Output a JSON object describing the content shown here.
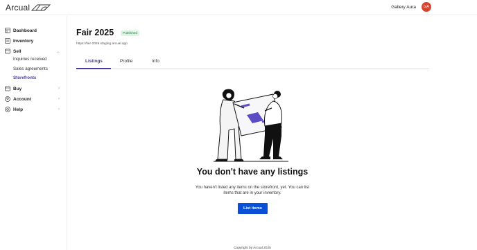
{
  "header": {
    "logo_text": "Arcual",
    "user_name": "Gallery Aura",
    "avatar_initials": "GA",
    "avatar_color": "#d9432f"
  },
  "sidebar": {
    "items": [
      {
        "label": "Dashboard",
        "icon": "dashboard-icon"
      },
      {
        "label": "Inventory",
        "icon": "inventory-icon"
      },
      {
        "label": "Sell",
        "icon": "sell-icon",
        "expanded": true,
        "children": [
          {
            "label": "Inquiries received"
          },
          {
            "label": "Sales agreements"
          },
          {
            "label": "Storefronts",
            "active": true
          }
        ]
      },
      {
        "label": "Buy",
        "icon": "buy-icon"
      },
      {
        "label": "Account",
        "icon": "account-icon"
      },
      {
        "label": "Help",
        "icon": "help-icon"
      }
    ]
  },
  "page": {
    "title": "Fair 2025",
    "status": "Published",
    "url": "https://fair-2025.staging.arcual.app"
  },
  "tabs": [
    {
      "label": "Listings",
      "active": true
    },
    {
      "label": "Profile"
    },
    {
      "label": "Info"
    }
  ],
  "empty_state": {
    "title": "You don't have any listings",
    "description": "You haven't listed any items on the storefront, yet. You can list items that are in your inventory.",
    "button_label": "List items"
  },
  "footer": {
    "text": "Copyright by Arcual 2025"
  },
  "colors": {
    "accent": "#4a3aa8",
    "primary_button": "#0a4fd6",
    "badge_bg": "#dff3e4",
    "badge_text": "#2e7d4a"
  }
}
